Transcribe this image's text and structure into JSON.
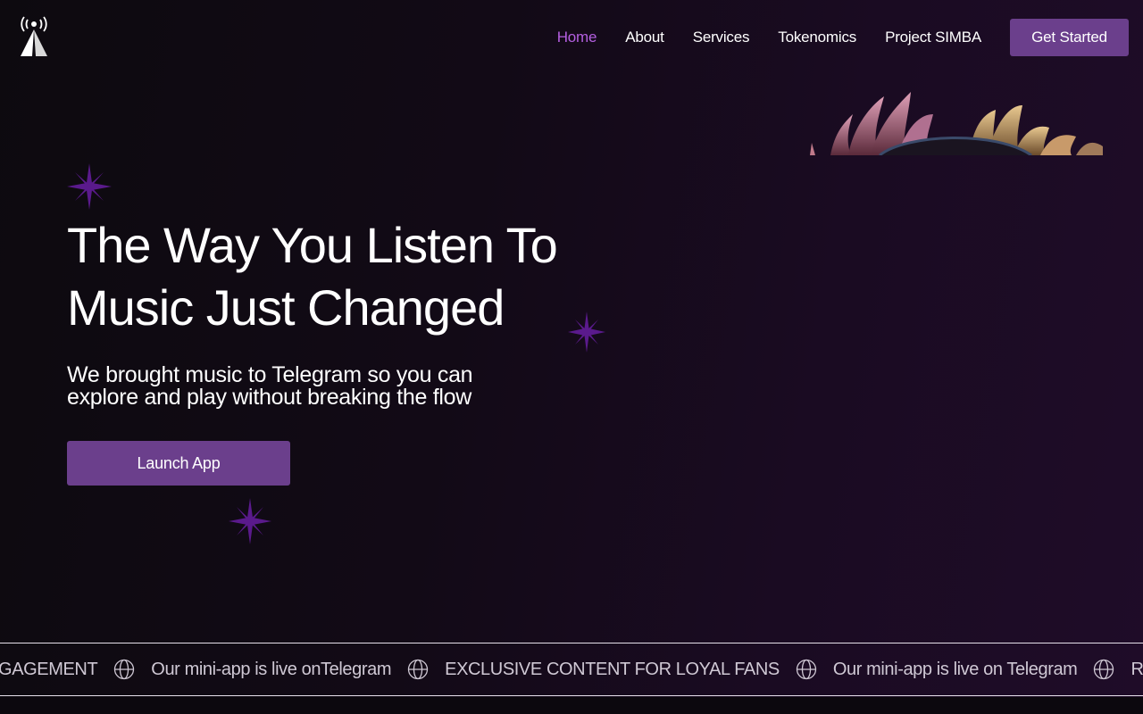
{
  "header": {
    "logo_icon": "broadcast-tower-icon",
    "nav": [
      {
        "label": "Home",
        "active": true
      },
      {
        "label": "About",
        "active": false
      },
      {
        "label": "Services",
        "active": false
      },
      {
        "label": "Tokenomics",
        "active": false
      },
      {
        "label": "Project SIMBA",
        "active": false
      }
    ],
    "cta_label": "Get Started"
  },
  "hero": {
    "title_line1": "The Way You Listen To",
    "title_line2": "Music Just Changed",
    "subtitle_line1": "We brought music to Telegram so you can",
    "subtitle_line2": "explore and play without breaking the flow",
    "launch_label": "Launch App"
  },
  "ticker": {
    "icon": "globe-icon",
    "items": [
      "NGAGEMENT",
      "Our mini-app is live onTelegram",
      "EXCLUSIVE CONTENT FOR LOYAL FANS",
      "Our mini-app is live on Telegram",
      "REVO"
    ]
  },
  "colors": {
    "accent": "#6b3f8c",
    "active_nav": "#b45fe0",
    "sparkle": "#5a1a8c",
    "background": "#120a16"
  }
}
